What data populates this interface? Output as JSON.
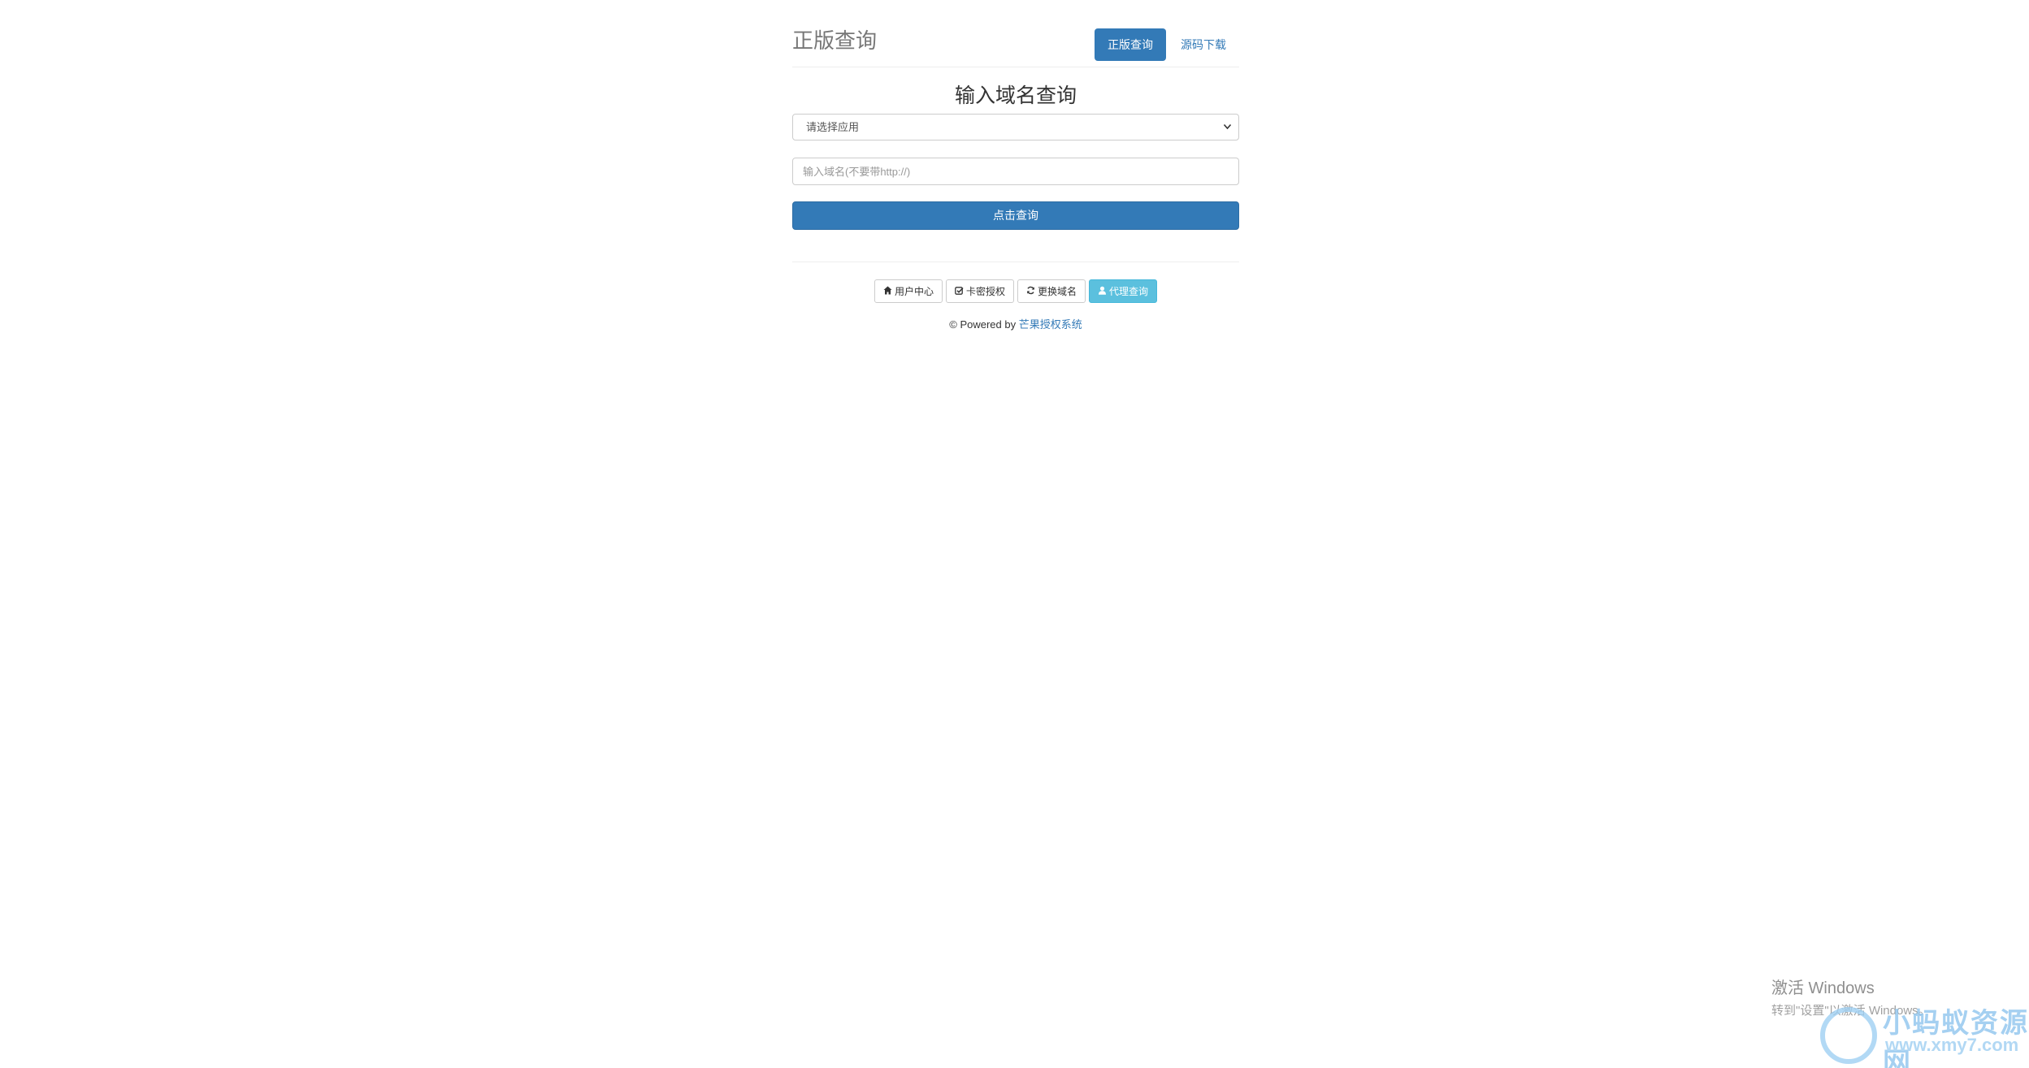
{
  "header": {
    "brand": "正版查询",
    "nav": [
      {
        "label": "正版查询",
        "active": true
      },
      {
        "label": "源码下载",
        "active": false
      }
    ]
  },
  "form": {
    "title": "输入域名查询",
    "select_value": "请选择应用",
    "domain_placeholder": "输入域名(不要带http://)",
    "submit_label": "点击查询"
  },
  "links": {
    "user_center": "用户中心",
    "card_auth": "卡密授权",
    "change_domain": "更换域名",
    "agent_query": "代理查询"
  },
  "footer": {
    "prefix": "© Powered by",
    "link": "芒果授权系统"
  },
  "watermark": {
    "title": "激活 Windows",
    "subtitle": "转到\"设置\"以激活 Windows。"
  },
  "site_logo": {
    "name": "小蚂蚁资源网",
    "url": "www.xmy7.com"
  },
  "colors": {
    "primary": "#337ab7",
    "info": "#5bc0de"
  }
}
